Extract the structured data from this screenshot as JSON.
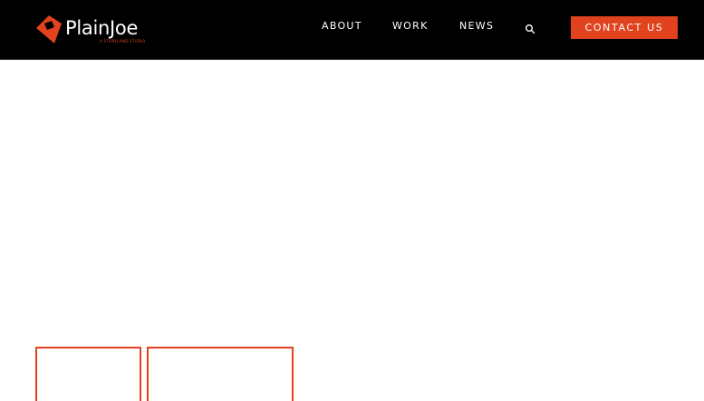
{
  "brand": {
    "name": "PlainJoe",
    "tagline": "A STORYLAND STUDIO",
    "accent_color": "#e0431d",
    "header_bg": "#000000",
    "logo_icon": "plainjoe-mark-icon"
  },
  "nav": {
    "items": [
      {
        "label": "ABOUT"
      },
      {
        "label": "WORK"
      },
      {
        "label": "NEWS"
      }
    ],
    "search_icon": "search-icon",
    "contact_label": "CONTACT US"
  }
}
